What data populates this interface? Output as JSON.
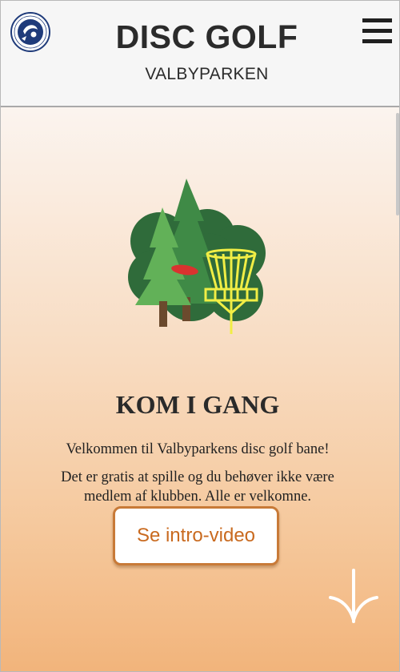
{
  "header": {
    "title": "DISC GOLF",
    "subtitle": "VALBYPARKEN",
    "logo_icon": "kbh-disc-golf-logo",
    "menu_icon": "hamburger-menu-icon"
  },
  "hero": {
    "illustration_icon": "disc-golf-basket-trees-illustration",
    "heading": "KOM I GANG",
    "welcome_text": "Velkommen til Valbyparkens disc golf bane!",
    "info_text": "Det er gratis at spille og du behøver ikke være medlem af klubben. Alle er velkomne.",
    "cta_label": "Se intro-video",
    "scroll_icon": "scroll-down-arrow-icon"
  },
  "colors": {
    "accent": "#c96a1f",
    "header_bg": "#f6f6f6",
    "gradient_top": "#fbf4ef",
    "gradient_bottom": "#f2b47b",
    "tree_dark": "#2f6b3a",
    "tree_light": "#62b158",
    "basket": "#f1ee45",
    "disc": "#d9332f"
  }
}
